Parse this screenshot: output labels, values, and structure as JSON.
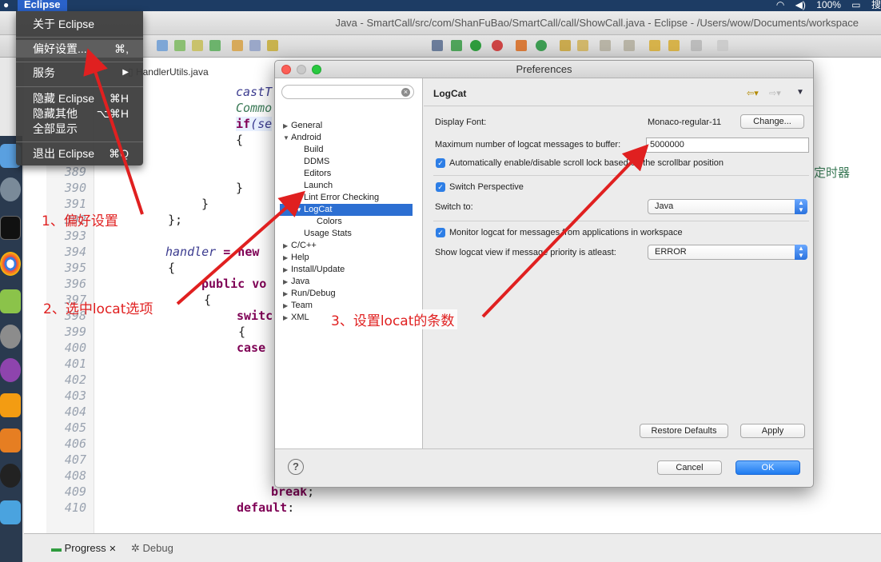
{
  "menubar": {
    "app_name": "Eclipse",
    "status": {
      "battery": "100%",
      "search_glyph": "搜"
    }
  },
  "window": {
    "title": "Java - SmartCall/src/com/ShanFuBao/SmartCall/call/ShowCall.java - Eclipse - /Users/wow/Documents/workspace"
  },
  "app_menu": {
    "items": [
      {
        "label": "关于 Eclipse",
        "shortcut": ""
      },
      {
        "label": "偏好设置...",
        "shortcut": "⌘,"
      },
      {
        "label": "服务",
        "shortcut": "▶"
      },
      {
        "label": "隐藏 Eclipse",
        "shortcut": "⌘H"
      },
      {
        "label": "隐藏其他",
        "shortcut": "⌥⌘H"
      },
      {
        "label": "全部显示",
        "shortcut": ""
      },
      {
        "label": "退出 Eclipse",
        "shortcut": "⌘Q"
      }
    ]
  },
  "editor": {
    "tab_label": "HandlerUtils.java",
    "line_numbers": [
      "389",
      "390",
      "391",
      "392",
      "393",
      "394",
      "395",
      "396",
      "397",
      "398",
      "399",
      "400",
      "401",
      "402",
      "403",
      "404",
      "405",
      "406",
      "407",
      "408",
      "409",
      "410"
    ],
    "code": {
      "l1": "castT",
      "l2": "Commo",
      "l3_kw": "if",
      "l3_rest": "(se",
      "l4": "{",
      "l5": "}",
      "l6": "}",
      "l7": "};",
      "l8_it": "handler",
      "l8_rest": " = new",
      "l9": "{",
      "l10_kw": "public vo",
      "l11": "{",
      "l12_kw": "switc",
      "l13": "{",
      "l14_kw": "case",
      "l15_kw": "break",
      "l15_rest": ";",
      "l16_kw": "default",
      "l16_rest": ":",
      "side_text": "定时器"
    }
  },
  "bottom_panel": {
    "tabs": [
      "Progress",
      "Debug"
    ]
  },
  "preferences": {
    "title": "Preferences",
    "search_placeholder": "",
    "tree": [
      {
        "label": "General",
        "arrow": "▶"
      },
      {
        "label": "Android",
        "arrow": "▼"
      },
      {
        "label": "Build",
        "arrow": ""
      },
      {
        "label": "DDMS",
        "arrow": ""
      },
      {
        "label": "Editors",
        "arrow": ""
      },
      {
        "label": "Launch",
        "arrow": ""
      },
      {
        "label": "Lint Error Checking",
        "arrow": ""
      },
      {
        "label": "LogCat",
        "arrow": "▼"
      },
      {
        "label": "Colors",
        "arrow": ""
      },
      {
        "label": "Usage Stats",
        "arrow": ""
      },
      {
        "label": "C/C++",
        "arrow": "▶"
      },
      {
        "label": "Help",
        "arrow": "▶"
      },
      {
        "label": "Install/Update",
        "arrow": "▶"
      },
      {
        "label": "Java",
        "arrow": "▶"
      },
      {
        "label": "Run/Debug",
        "arrow": "▶"
      },
      {
        "label": "Team",
        "arrow": "▶"
      },
      {
        "label": "XML",
        "arrow": "▶"
      }
    ],
    "page": {
      "title": "LogCat",
      "display_font_label": "Display Font:",
      "display_font_value": "Monaco-regular-11",
      "change_button": "Change...",
      "max_messages_label": "Maximum number of logcat messages to buffer:",
      "max_messages_value": "5000000",
      "scroll_lock_label": "Automatically enable/disable scroll lock based on the scrollbar position",
      "switch_perspective_label": "Switch Perspective",
      "switch_to_label": "Switch to:",
      "switch_to_value": "Java",
      "monitor_label": "Monitor logcat for messages from applications in workspace",
      "show_view_label": "Show logcat view if message priority is atleast:",
      "show_view_value": "ERROR",
      "restore_defaults": "Restore Defaults",
      "apply": "Apply"
    },
    "help_glyph": "?",
    "cancel": "Cancel",
    "ok": "OK"
  },
  "annotations": {
    "step1": "1、偏好设置",
    "step2": "2、选中locat选项",
    "step3": "3、设置locat的条数"
  },
  "colors": {
    "accent": "#2c6fd2",
    "annotation": "#e02020"
  }
}
